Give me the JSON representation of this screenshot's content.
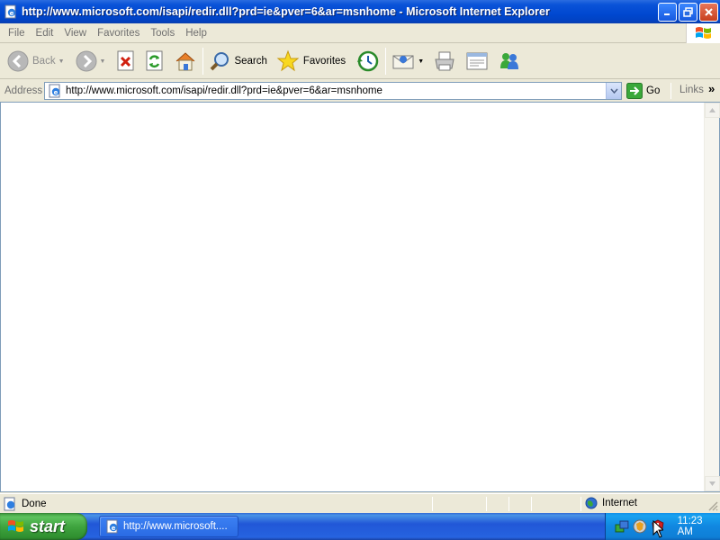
{
  "window": {
    "title": "http://www.microsoft.com/isapi/redir.dll?prd=ie&pver=6&ar=msnhome - Microsoft Internet Explorer",
    "app_icon": "ie-page-icon",
    "controls": [
      "minimize-icon",
      "maximize-icon",
      "close-icon"
    ]
  },
  "menu": {
    "items": [
      {
        "label": "File"
      },
      {
        "label": "Edit"
      },
      {
        "label": "View"
      },
      {
        "label": "Favorites"
      },
      {
        "label": "Tools"
      },
      {
        "label": "Help"
      }
    ],
    "logo": "windows-flag-icon"
  },
  "toolbar": {
    "back_label": "Back",
    "search_label": "Search",
    "favorites_label": "Favorites",
    "icons": [
      "back-icon",
      "forward-icon",
      "stop-icon",
      "refresh-icon",
      "home-icon",
      "search-icon",
      "favorites-star-icon",
      "history-icon",
      "mail-icon",
      "print-icon",
      "edit-icon",
      "messenger-icon"
    ]
  },
  "address": {
    "label": "Address",
    "url": "http://www.microsoft.com/isapi/redir.dll?prd=ie&pver=6&ar=msnhome",
    "go_label": "Go",
    "links_label": "Links"
  },
  "status": {
    "text": "Done",
    "zone": "Internet"
  },
  "taskbar": {
    "start_label": "start",
    "task_label": "http://www.microsoft....",
    "clock": "11:23 AM"
  },
  "colors": {
    "titlebar": "#0a53d8",
    "chrome": "#ece9d8",
    "taskbar": "#2157d7",
    "start": "#3fa43f",
    "tray": "#1087e0"
  }
}
